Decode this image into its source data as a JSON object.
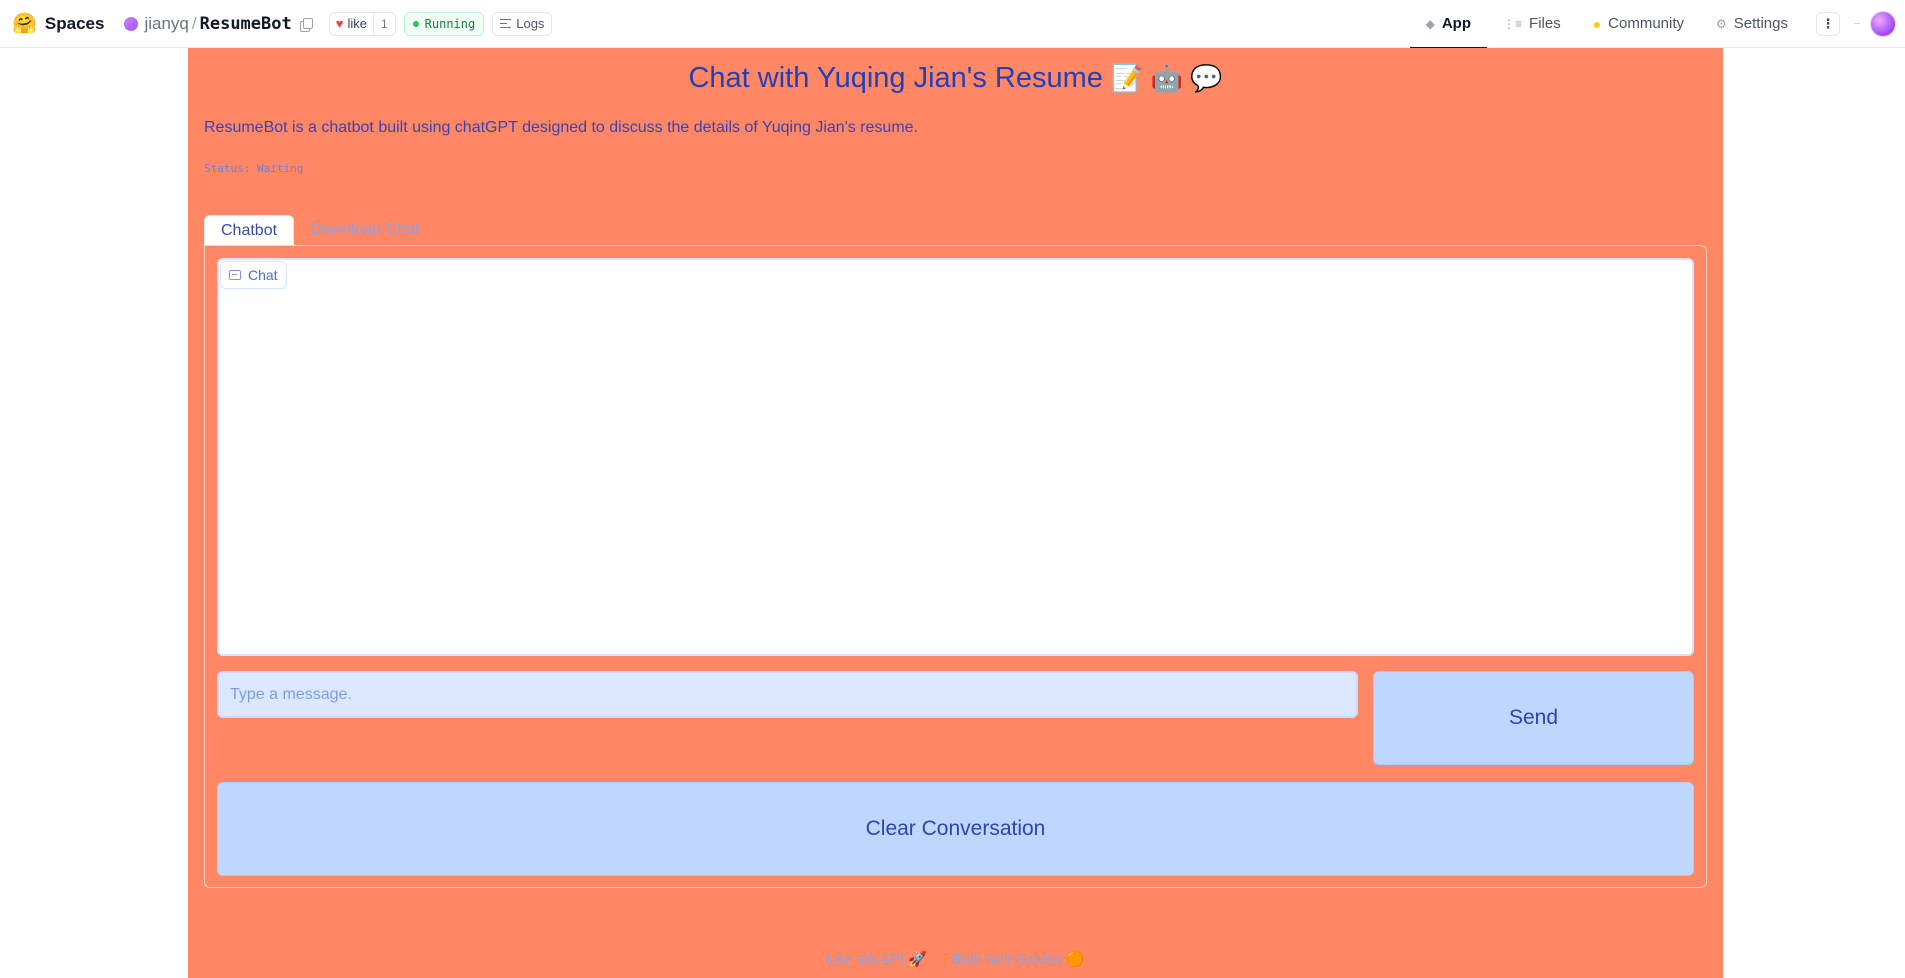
{
  "topbar": {
    "brand_logo": "🤗",
    "brand": "Spaces",
    "owner": "jianyq",
    "slash": "/",
    "repo": "ResumeBot",
    "like_label": "like",
    "like_count": "1",
    "status": "Running",
    "logs": "Logs",
    "nav": {
      "app": "App",
      "files": "Files",
      "community": "Community",
      "settings": "Settings"
    },
    "menu_glyph": "⋮"
  },
  "app": {
    "title": "Chat with Yuqing Jian's Resume",
    "title_emoji": "📝 🤖 💬",
    "description": "ResumeBot is a chatbot built using chatGPT designed to discuss the details of Yuqing Jian's resume.",
    "status_line": "Status: Waiting",
    "tabs": [
      "Chatbot",
      "Download Chat"
    ],
    "chat_label": "Chat",
    "message_placeholder": "Type a message.",
    "send_label": "Send",
    "clear_label": "Clear Conversation",
    "footer": {
      "api": "Use via API",
      "api_emoji": "🚀",
      "sep": "·",
      "built": "Built with Gradio",
      "built_emoji": "🟠"
    }
  },
  "colors": {
    "app_bg": "#ff8763",
    "primary_text": "#2340b8",
    "button_bg": "#bfd7ff",
    "input_bg": "#dbe8ff"
  },
  "icons": {
    "nav_app": "cube-icon",
    "nav_files": "files-icon",
    "nav_community": "community-icon",
    "nav_settings": "gear-icon"
  }
}
